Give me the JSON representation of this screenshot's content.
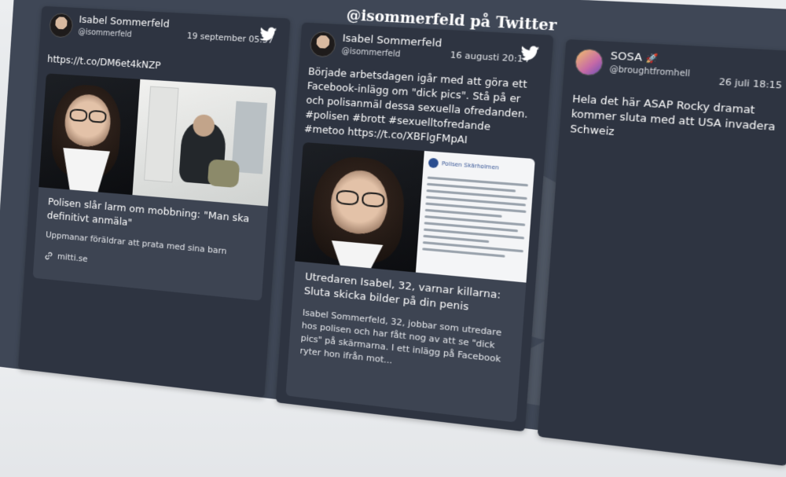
{
  "board": {
    "title": "@isommerfeld på Twitter"
  },
  "tweets": [
    {
      "name": "Isabel Sommerfeld",
      "handle": "@isommerfeld",
      "date": "19 september 05:57",
      "text": "https://t.co/DM6et4kNZP",
      "card": {
        "title": "Polisen slår larm om mobbning: \"Man ska definitivt anmäla\"",
        "description": "Uppmanar föräldrar att prata med sina barn",
        "domain": "mitti.se"
      }
    },
    {
      "name": "Isabel Sommerfeld",
      "handle": "@isommerfeld",
      "date": "16 augusti 20:14",
      "text": "Började arbetsdagen igår med att göra ett Facebook-inlägg om \"dick pics\". Stå på er och polisanmäl dessa sexuella ofredanden. #polisen #brott #sexuelltofredande #metoo  https://t.co/XBFlgFMpAI",
      "card": {
        "title": "Utredaren Isabel, 32, varnar killarna: Sluta skicka bilder på din penis",
        "description": "Isabel Sommerfeld, 32, jobbar som utredare hos polisen och har fått nog av att se \"dick pics\" på skärmarna. I ett inlägg på Facebook ryter hon ifrån mot..."
      },
      "inset_header": "Polisen Skärholmen"
    },
    {
      "name": "SOSA",
      "name_emoji": "🚀",
      "handle": "@broughtfromhell",
      "date": "26 juli 18:15",
      "text": "Hela det här ASAP Rocky dramat kommer sluta med att USA invadera Schweiz"
    }
  ],
  "colors": {
    "board": "#3f4756",
    "card": "#2e3441",
    "media": "#3d4452",
    "text": "#ffffff"
  },
  "icons": [
    "twitter-bird-icon",
    "link-icon"
  ]
}
